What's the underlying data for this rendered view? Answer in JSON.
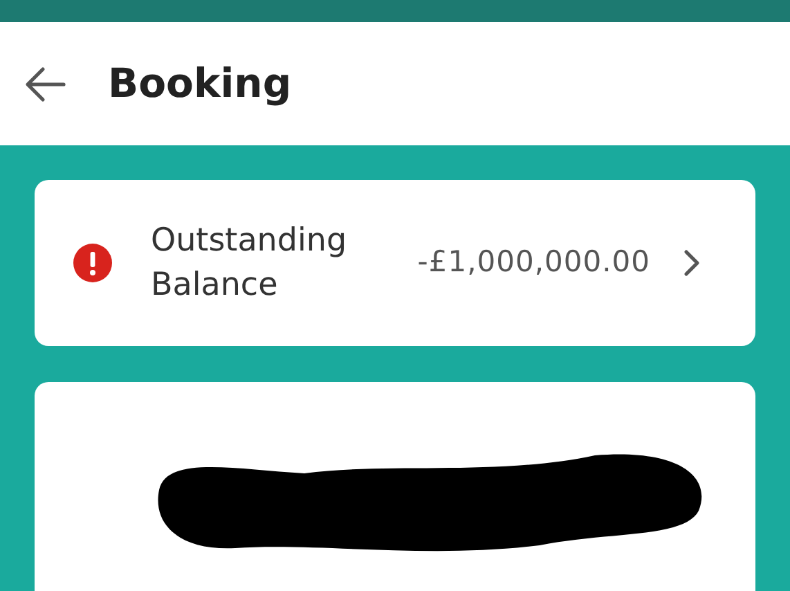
{
  "header": {
    "title": "Booking"
  },
  "balance_card": {
    "label": "Outstanding Balance",
    "amount": "-£1,000,000.00"
  }
}
